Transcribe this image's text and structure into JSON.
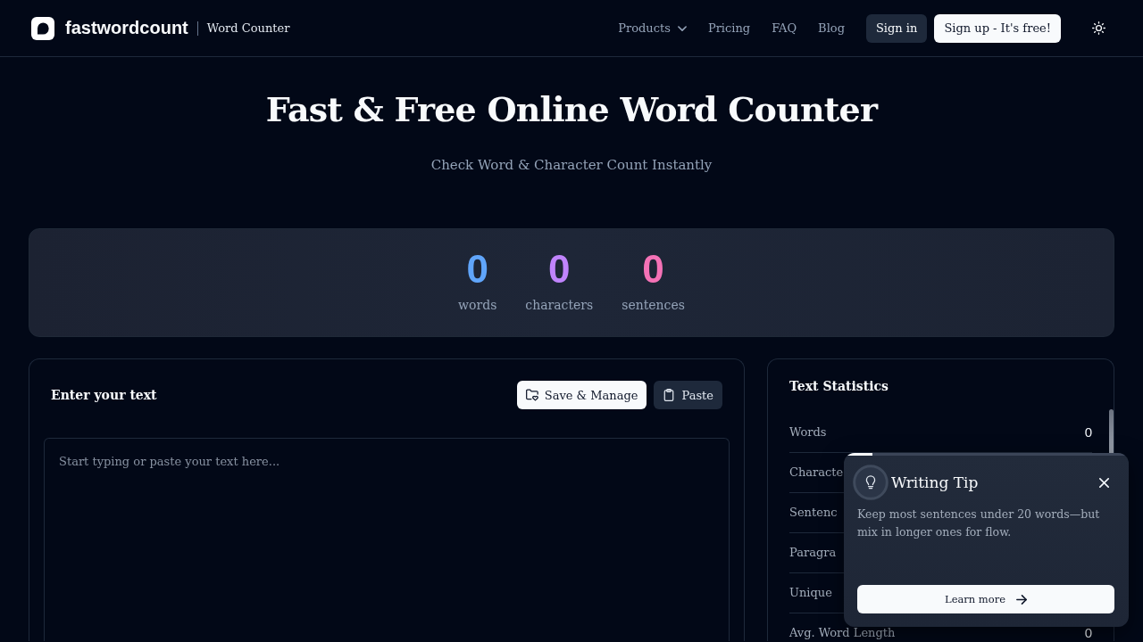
{
  "header": {
    "brand": {
      "name": "fastwordcount",
      "tagline": "Word Counter"
    },
    "nav": [
      {
        "label": "Products",
        "kind": "dropdown"
      },
      {
        "label": "Pricing",
        "kind": "link"
      },
      {
        "label": "FAQ",
        "kind": "link"
      },
      {
        "label": "Blog",
        "kind": "link"
      }
    ],
    "actions": [
      {
        "label": "Sign in",
        "kind": "secondary"
      },
      {
        "label": "Sign up - It's free!",
        "kind": "primary"
      }
    ]
  },
  "hero": {
    "title": "Fast & Free Online Word Counter",
    "subtitle": "Check Word & Character Count Instantly"
  },
  "summary": [
    {
      "value": "0",
      "label": "words",
      "color": "#60a5fa"
    },
    {
      "value": "0",
      "label": "characters",
      "color": "#c084fc"
    },
    {
      "value": "0",
      "label": "sentences",
      "color": "#f472b6"
    }
  ],
  "editor": {
    "title": "Enter your text",
    "buttons": [
      {
        "label": "Save & Manage",
        "kind": "primary"
      },
      {
        "label": "Paste",
        "kind": "secondary"
      }
    ],
    "placeholder": "Start typing or paste your text here..."
  },
  "statistics": {
    "title": "Text Statistics",
    "rows": [
      {
        "label": "Words",
        "value": "0"
      },
      {
        "label": "Characte"
      },
      {
        "label": "Sentenc"
      },
      {
        "label": "Paragra"
      },
      {
        "label": "Unique"
      },
      {
        "label": "Avg. Word Length",
        "value": "0"
      }
    ]
  },
  "tip": {
    "title": "Writing Tip",
    "text": "Keep most sentences under 20 words—but mix in longer ones for flow.",
    "level": 0.1,
    "button": "Learn more"
  }
}
